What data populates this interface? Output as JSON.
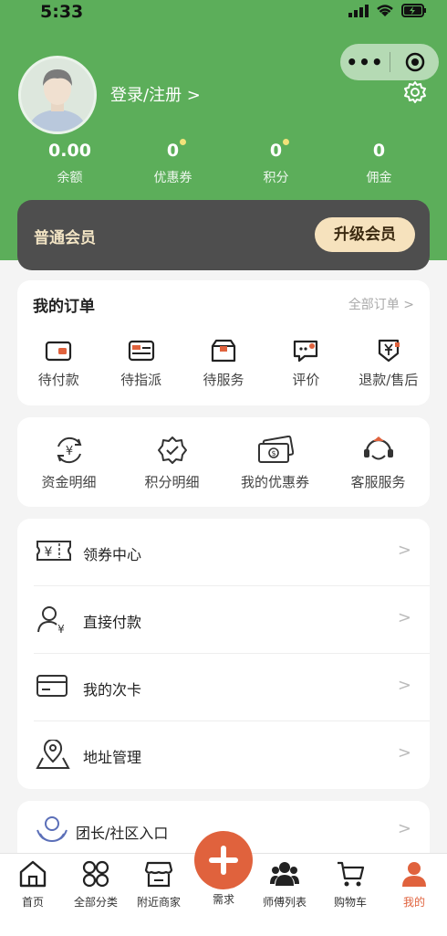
{
  "status_bar": {
    "time": "5:33"
  },
  "profile": {
    "login_label": "登录/注册 >"
  },
  "stats": [
    {
      "value": "0.00",
      "label": "余额"
    },
    {
      "value": "0",
      "label": "优惠券"
    },
    {
      "value": "0",
      "label": "积分"
    },
    {
      "value": "0",
      "label": "佣金"
    }
  ],
  "member": {
    "title": "普通会员",
    "upgrade_label": "升级会员"
  },
  "orders": {
    "title": "我的订单",
    "all_label": "全部订单",
    "items": [
      {
        "label": "待付款",
        "icon": "wallet-icon"
      },
      {
        "label": "待指派",
        "icon": "card-assign-icon"
      },
      {
        "label": "待服务",
        "icon": "box-icon"
      },
      {
        "label": "评价",
        "icon": "comment-icon"
      },
      {
        "label": "退款/售后",
        "icon": "refund-icon"
      }
    ]
  },
  "services": {
    "items": [
      {
        "label": "资金明细",
        "icon": "yuan-cycle-icon"
      },
      {
        "label": "积分明细",
        "icon": "badge-check-icon"
      },
      {
        "label": "我的优惠券",
        "icon": "coupon-ticket-icon"
      },
      {
        "label": "客服服务",
        "icon": "headset-icon"
      }
    ]
  },
  "menu": {
    "items": [
      {
        "label": "领券中心",
        "icon": "coupon-icon"
      },
      {
        "label": "直接付款",
        "icon": "user-pay-icon"
      },
      {
        "label": "我的次卡",
        "icon": "card-icon"
      },
      {
        "label": "地址管理",
        "icon": "location-icon"
      }
    ]
  },
  "group_entry": {
    "label": "团长/社区入口",
    "icon": "group-icon"
  },
  "tabbar": {
    "items": [
      {
        "label": "首页",
        "icon": "home-icon"
      },
      {
        "label": "全部分类",
        "icon": "grid-icon"
      },
      {
        "label": "附近商家",
        "icon": "shop-icon"
      },
      {
        "label": "需求",
        "icon": "plus-icon"
      },
      {
        "label": "师傅列表",
        "icon": "workers-icon"
      },
      {
        "label": "购物车",
        "icon": "cart-icon"
      },
      {
        "label": "我的",
        "icon": "user-icon"
      }
    ],
    "active": "我的"
  },
  "colors": {
    "brand_green": "#5cae5a",
    "accent_orange": "#e0623d",
    "member_gold": "#f6e2bd"
  }
}
